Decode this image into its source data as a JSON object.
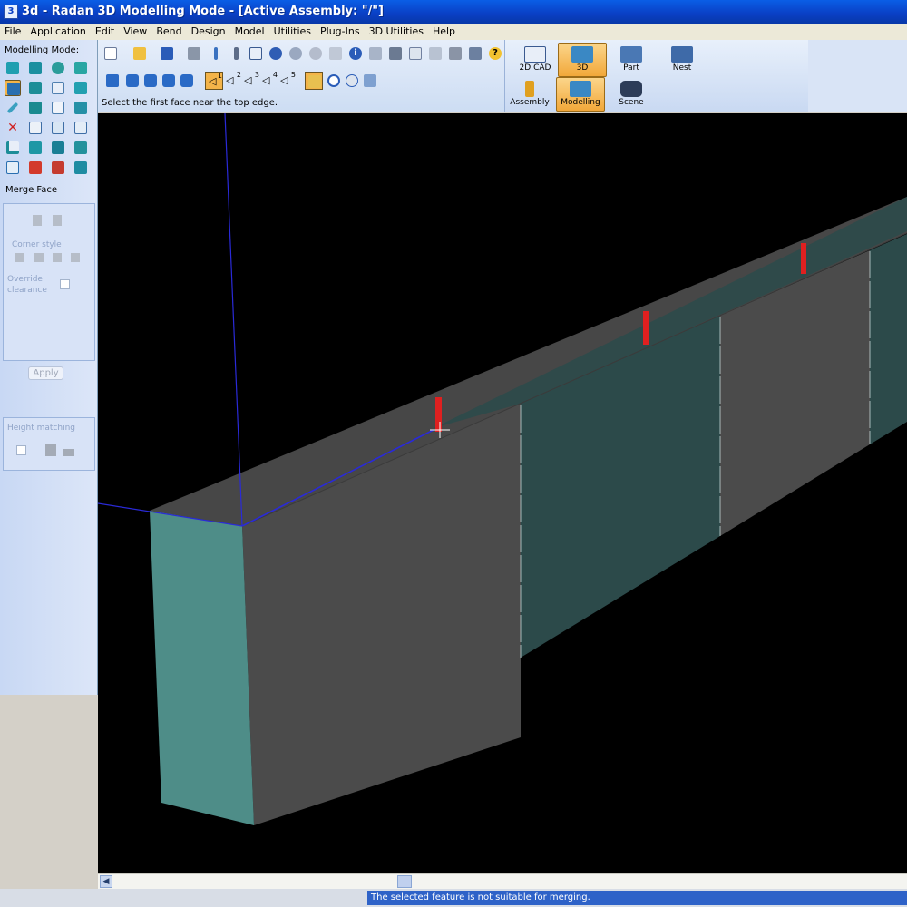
{
  "window": {
    "title": "3d - Radan 3D Modelling Mode - [Active Assembly: \"/\"]",
    "app_icon": "3d-app-icon"
  },
  "menu": [
    "File",
    "Application",
    "Edit",
    "View",
    "Bend",
    "Design",
    "Model",
    "Utilities",
    "Plug-Ins",
    "3D Utilities",
    "Help"
  ],
  "left_panel": {
    "modelling_mode_label": "Modelling Mode:",
    "merge_face_label": "Merge Face",
    "corner_style_label": "Corner style",
    "override_label_1": "Override",
    "override_label_2": "clearance",
    "apply_label": "Apply",
    "height_matching_label": "Height matching"
  },
  "toolbar": {
    "prompt": "Select the first face near the top edge.",
    "face_selectors": [
      "1",
      "2",
      "3",
      "4",
      "5"
    ]
  },
  "modes": [
    {
      "label": "2D CAD",
      "icon": "2d-cad-icon",
      "active": false
    },
    {
      "label": "3D",
      "icon": "3d-icon",
      "active": true
    },
    {
      "label": "Part",
      "icon": "part-icon",
      "active": false
    },
    {
      "label": "Nest",
      "icon": "nest-icon",
      "active": false
    },
    {
      "label": "Assembly",
      "icon": "assembly-wrench-icon",
      "active": false
    },
    {
      "label": "Modelling",
      "icon": "modelling-icon",
      "active": true
    },
    {
      "label": "Scene",
      "icon": "scene-camera-icon",
      "active": false
    }
  ],
  "status": {
    "message": "The selected feature is not suitable for merging."
  },
  "colors": {
    "titlebar": "#0a3fc4",
    "active_tool": "#f4b449",
    "viewport_bg": "#000000",
    "face_gray": "#4b4b4b",
    "face_teal": "#2c4a4a",
    "end_face_teal": "#4e8d88",
    "marker_red": "#e02020",
    "axis_blue": "#2a2ad8"
  }
}
